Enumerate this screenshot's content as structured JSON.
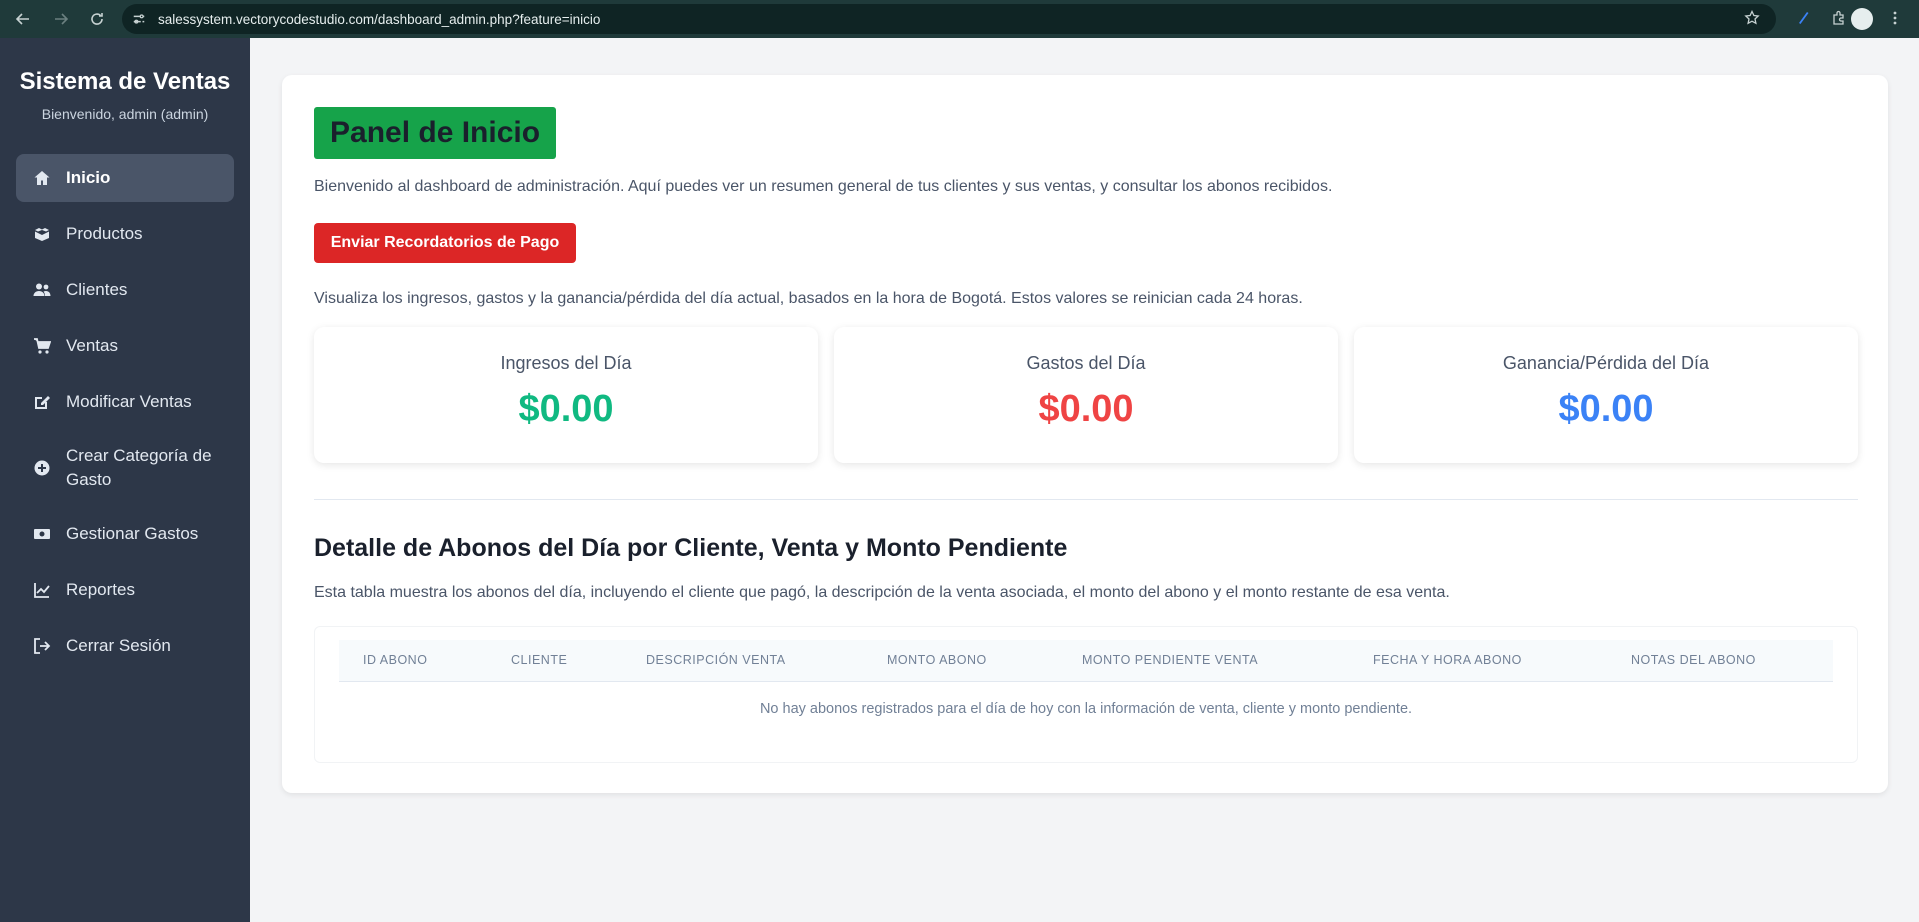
{
  "browser": {
    "url": "salessystem.vectorycodestudio.com/dashboard_admin.php?feature=inicio"
  },
  "sidebar": {
    "title": "Sistema de Ventas",
    "welcome": "Bienvenido, admin (admin)",
    "items": [
      {
        "label": "Inicio",
        "icon": "home-icon"
      },
      {
        "label": "Productos",
        "icon": "boxes-icon"
      },
      {
        "label": "Clientes",
        "icon": "users-icon"
      },
      {
        "label": "Ventas",
        "icon": "cart-icon"
      },
      {
        "label": "Modificar Ventas",
        "icon": "edit-icon"
      },
      {
        "label": "Crear Categoría de Gasto",
        "icon": "plus-circle-icon"
      },
      {
        "label": "Gestionar Gastos",
        "icon": "money-icon"
      },
      {
        "label": "Reportes",
        "icon": "chart-line-icon"
      },
      {
        "label": "Cerrar Sesión",
        "icon": "logout-icon"
      }
    ]
  },
  "main": {
    "title": "Panel de Inicio",
    "intro": "Bienvenido al dashboard de administración. Aquí puedes ver un resumen general de tus clientes y sus ventas, y consultar los abonos recibidos.",
    "reminder_button": "Enviar Recordatorios de Pago",
    "visualiza": "Visualiza los ingresos, gastos y la ganancia/pérdida del día actual, basados en la hora de Bogotá. Estos valores se reinician cada 24 horas.",
    "stats": [
      {
        "label": "Ingresos del Día",
        "value": "$0.00",
        "color": "#10b981"
      },
      {
        "label": "Gastos del Día",
        "value": "$0.00",
        "color": "#ef4444"
      },
      {
        "label": "Ganancia/Pérdida del Día",
        "value": "$0.00",
        "color": "#3b82f6"
      }
    ],
    "detail_title": "Detalle de Abonos del Día por Cliente, Venta y Monto Pendiente",
    "detail_desc": "Esta tabla muestra los abonos del día, incluyendo el cliente que pagó, la descripción de la venta asociada, el monto del abono y el monto restante de esa venta.",
    "table": {
      "headers": [
        "ID ABONO",
        "CLIENTE",
        "DESCRIPCIÓN VENTA",
        "MONTO ABONO",
        "MONTO PENDIENTE VENTA",
        "FECHA Y HORA ABONO",
        "NOTAS DEL ABONO"
      ],
      "empty": "No hay abonos registrados para el día de hoy con la información de venta, cliente y monto pendiente."
    }
  }
}
